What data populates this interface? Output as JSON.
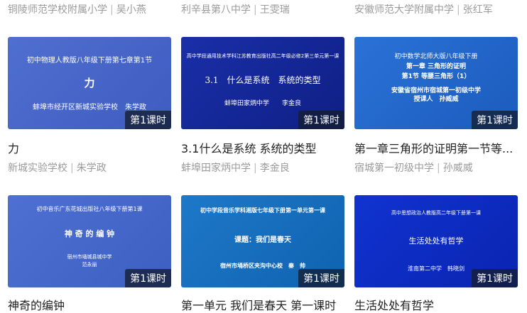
{
  "top_meta": [
    {
      "school": "铜陵师范学校附属小学",
      "teacher": "吴小燕"
    },
    {
      "school": "利辛县第八中学",
      "teacher": "王雯瑞"
    },
    {
      "school": "安徽师范大学附属中学",
      "teacher": "张红军"
    }
  ],
  "badge": "第1课时",
  "cards": [
    {
      "thumb": [
        "初中物理人教版八年级下册第七章第1节",
        "力",
        "蚌埠市经开区新城实验学校　朱学政"
      ],
      "title": "力",
      "school": "新城实验学校",
      "teacher": "朱学政"
    },
    {
      "thumb": [
        "高中学段通用技术学科江苏教育出版社高二年级必修2第三单元第一课",
        "3.1　什么是系统　系统的类型",
        "蚌埠田家炳中学　　李金良"
      ],
      "title": "3.1什么是系统 系统的类型",
      "school": "蚌埠田家炳中学",
      "teacher": "李金良"
    },
    {
      "thumb": [
        "初中数学北师大版八年级下册",
        "第一章 三角形的证明",
        "第1节 等腰三角形（1）",
        "安徽省宿州市宿城第一初级中学",
        "授课人　孙威威"
      ],
      "title": "第一章三角形的证明第一节等...",
      "school": "宿城第一初级中学",
      "teacher": "孙威威"
    },
    {
      "thumb": [
        "初中音乐广东花城出版社八年级下册第1课",
        "神 奇 的 编 钟",
        "宿州市埇城县城中学",
        "范永丽"
      ],
      "title": "神奇的编钟"
    },
    {
      "thumb": [
        "初中学段音乐学科湘版七年级下册第一单元第一课",
        "课题：我们是春天",
        "宿州市埇桥区夹沟中心校　秦　帅"
      ],
      "title": "第一单元 我们是春天 第一课时"
    },
    {
      "thumb": [
        "高中思想政治人教版高二年级下册第一课",
        "生活处处有哲学",
        "淮南第二中学　韩晓剑"
      ],
      "title": "生活处处有哲学"
    }
  ]
}
